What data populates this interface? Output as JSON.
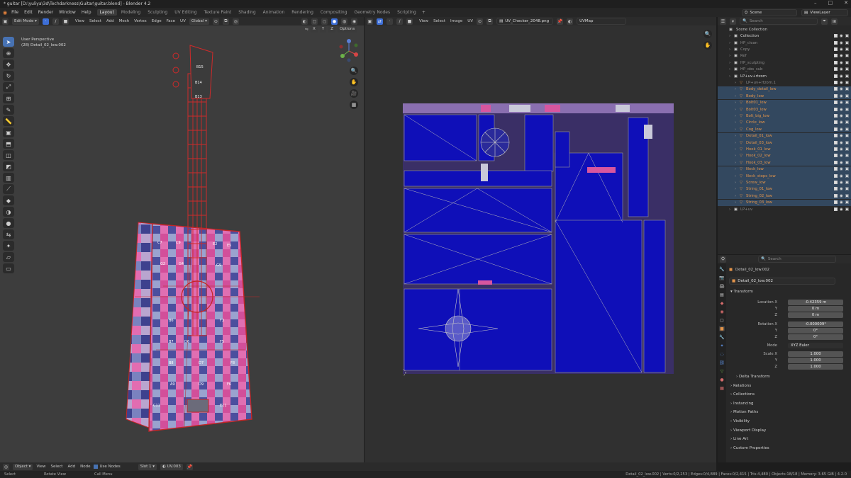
{
  "window": {
    "title": "* guitar [D:\\yuliya\\3d\\Techdarkness\\Guitar\\guitar.blend] - Blender 4.2"
  },
  "menu": [
    "File",
    "Edit",
    "Render",
    "Window",
    "Help"
  ],
  "workspaces": [
    "Layout",
    "Modeling",
    "Sculpting",
    "UV Editing",
    "Texture Paint",
    "Shading",
    "Animation",
    "Rendering",
    "Compositing",
    "Geometry Nodes",
    "Scripting"
  ],
  "active_workspace": "Layout",
  "scene": {
    "name": "Scene",
    "view_layer": "ViewLayer"
  },
  "viewport3d": {
    "mode": "Edit Mode",
    "menus": [
      "View",
      "Select",
      "Add",
      "Mesh",
      "Vertex",
      "Edge",
      "Face",
      "UV"
    ],
    "orientation": "Global",
    "options": "Options",
    "axes": [
      "X",
      "Y",
      "Z"
    ],
    "perspective": "User Perspective",
    "object_label": "(28) Detail_02_low.002",
    "neck_labels": [
      "B15",
      "B14",
      "B13"
    ],
    "body_labels": [
      "C7",
      "C9",
      "E2",
      "E5",
      "G2",
      "G4",
      "G9",
      "B6",
      "B7",
      "B8",
      "F3",
      "F5",
      "C11",
      "E11",
      "D7",
      "F8",
      "A9",
      "D9",
      "F6",
      "D6"
    ]
  },
  "uv_editor": {
    "menus": [
      "View",
      "Select",
      "Image",
      "UV"
    ],
    "image": "UV_Checker_2048.png",
    "uvmap": "UVMap"
  },
  "outliner": {
    "search_placeholder": "Search",
    "root": "Scene Collection",
    "items": [
      {
        "name": "Collection",
        "indent": 1,
        "sel": false,
        "col": "#d6d6d6"
      },
      {
        "name": "HP_clean",
        "indent": 1,
        "sel": false,
        "col": "#8a8a8a"
      },
      {
        "name": "Copy",
        "indent": 1,
        "sel": false,
        "col": "#8a8a8a"
      },
      {
        "name": "Ref",
        "indent": 1,
        "sel": false,
        "col": "#8a8a8a"
      },
      {
        "name": "HP_sculpting",
        "indent": 1,
        "sel": false,
        "col": "#8a8a8a"
      },
      {
        "name": "HP_obs_sub",
        "indent": 1,
        "sel": false,
        "col": "#8a8a8a"
      },
      {
        "name": "LP+uv+rtzom",
        "indent": 1,
        "sel": false,
        "col": "#d6d6d6"
      },
      {
        "name": "LP+uv+rtzom.1",
        "indent": 2,
        "sel": false,
        "col": "#8a8a8a"
      },
      {
        "name": "Body_detail_low",
        "indent": 2,
        "sel": true,
        "col": "#e3944a"
      },
      {
        "name": "Body_low",
        "indent": 2,
        "sel": true,
        "col": "#e3944a"
      },
      {
        "name": "Bolt01_low",
        "indent": 2,
        "sel": true,
        "col": "#e3944a"
      },
      {
        "name": "Bolt03_low",
        "indent": 2,
        "sel": true,
        "col": "#e3944a"
      },
      {
        "name": "Bolt_big_low",
        "indent": 2,
        "sel": true,
        "col": "#e3944a"
      },
      {
        "name": "Circle_low",
        "indent": 2,
        "sel": true,
        "col": "#e3944a"
      },
      {
        "name": "Cog_low",
        "indent": 2,
        "sel": true,
        "col": "#e3944a"
      },
      {
        "name": "Detail_01_low",
        "indent": 2,
        "sel": true,
        "col": "#e3944a"
      },
      {
        "name": "Detail_03_low",
        "indent": 2,
        "sel": true,
        "col": "#e3944a"
      },
      {
        "name": "Hook_01_low",
        "indent": 2,
        "sel": true,
        "col": "#e3944a"
      },
      {
        "name": "Hook_02_low",
        "indent": 2,
        "sel": true,
        "col": "#e3944a"
      },
      {
        "name": "Hook_03_low",
        "indent": 2,
        "sel": true,
        "col": "#e3944a"
      },
      {
        "name": "Neck_low",
        "indent": 2,
        "sel": true,
        "col": "#e3944a"
      },
      {
        "name": "Neck_stops_low",
        "indent": 2,
        "sel": true,
        "col": "#e3944a"
      },
      {
        "name": "Screw_low",
        "indent": 2,
        "sel": true,
        "col": "#e3944a"
      },
      {
        "name": "String_01_low",
        "indent": 2,
        "sel": true,
        "col": "#e3944a"
      },
      {
        "name": "String_02_low",
        "indent": 2,
        "sel": true,
        "col": "#e3944a"
      },
      {
        "name": "String_03_low",
        "indent": 2,
        "sel": true,
        "col": "#e3944a"
      },
      {
        "name": "LP+uv",
        "indent": 1,
        "sel": false,
        "col": "#8a8a8a"
      }
    ]
  },
  "properties": {
    "search_placeholder": "Search",
    "object": "Detail_02_low.002",
    "data": "Detail_02_low.002",
    "transform_title": "Transform",
    "location": {
      "label": "Location X",
      "x": "-0.42359 m",
      "y": "0 m",
      "z": "0 m"
    },
    "rotation": {
      "label": "Rotation X",
      "x": "-0.000009°",
      "y": "0°",
      "z": "0°"
    },
    "mode": {
      "label": "Mode",
      "value": "XYZ Euler"
    },
    "scale": {
      "label": "Scale X",
      "x": "1.000",
      "y": "1.000",
      "z": "1.000"
    },
    "axis_y": "Y",
    "axis_z": "Z",
    "sections": [
      "Delta Transform",
      "Relations",
      "Collections",
      "Instancing",
      "Motion Paths",
      "Visibility",
      "Viewport Display",
      "Line Art",
      "Custom Properties"
    ]
  },
  "bottom_header": {
    "mode": "Object",
    "menus": [
      "View",
      "Select",
      "Add",
      "Node"
    ],
    "use_nodes": "Use Nodes",
    "slot": "Slot 1",
    "uv": "UV.003"
  },
  "statusbar": {
    "left": [
      "Select",
      "Rotate View",
      "Call Menu"
    ],
    "right": "Detail_02_low.002 | Verts:0/2,253 | Edges:0/4,889 | Faces:0/2,415 | Tris:4,480 | Objects:18/18 | Memory: 3.65 GiB | 4.2.0"
  }
}
